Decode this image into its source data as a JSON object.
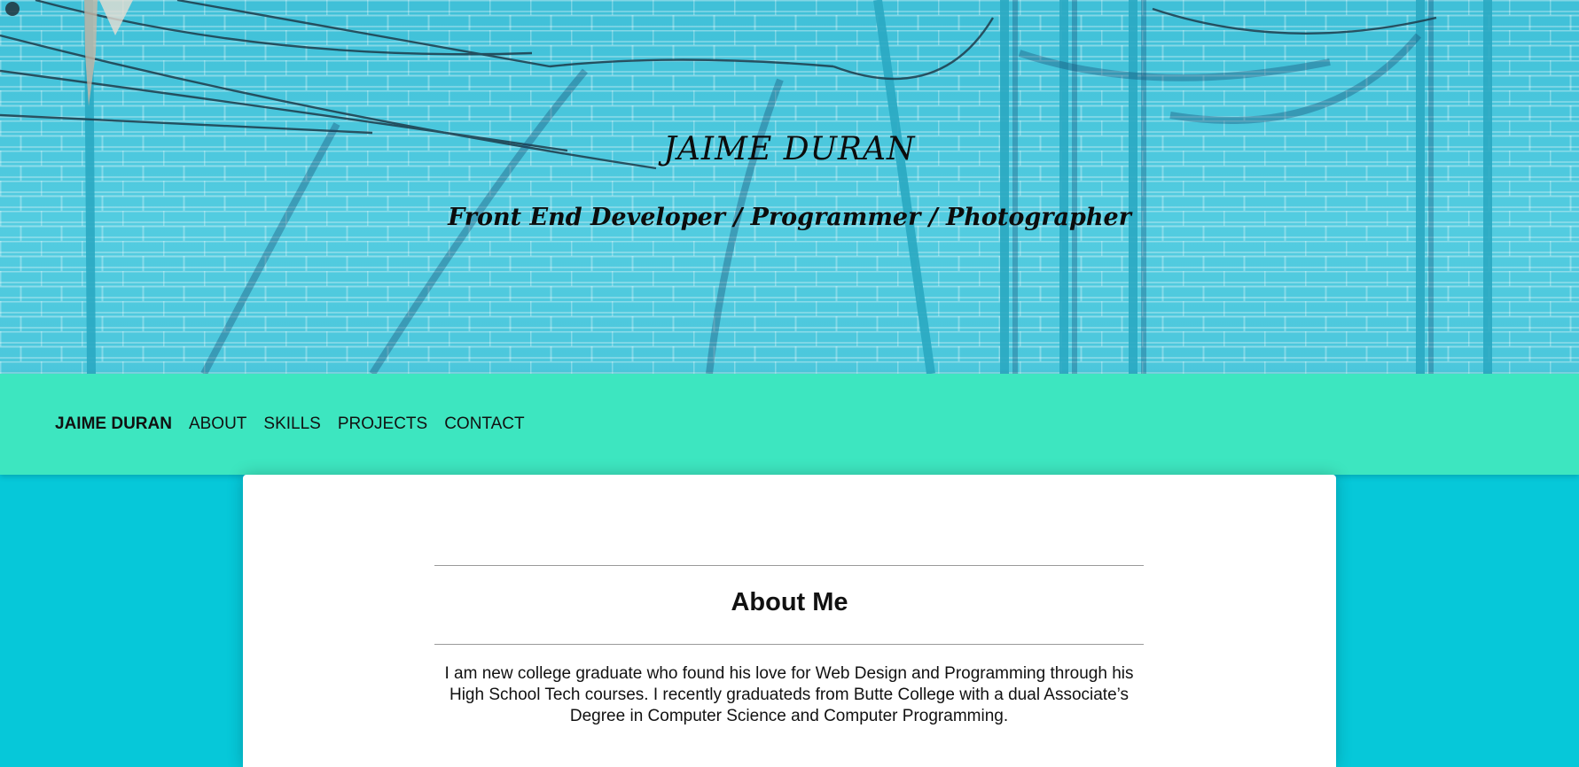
{
  "hero": {
    "title": "JAIME DURAN",
    "subtitle": "Front End Developer / Programmer / Photographer",
    "background_color": "#49c6dc"
  },
  "nav": {
    "brand": "JAIME DURAN",
    "links": [
      "ABOUT",
      "SKILLS",
      "PROJECTS",
      "CONTACT"
    ],
    "background_color": "#3de6c0"
  },
  "about": {
    "title": "About Me",
    "body": "I am new college graduate who found his love for Web Design and Programming through his High School Tech courses. I recently graduateds from Butte College with a dual Associate’s Degree in Computer Science and Computer Programming."
  },
  "page": {
    "background_color": "#06c8d9"
  }
}
